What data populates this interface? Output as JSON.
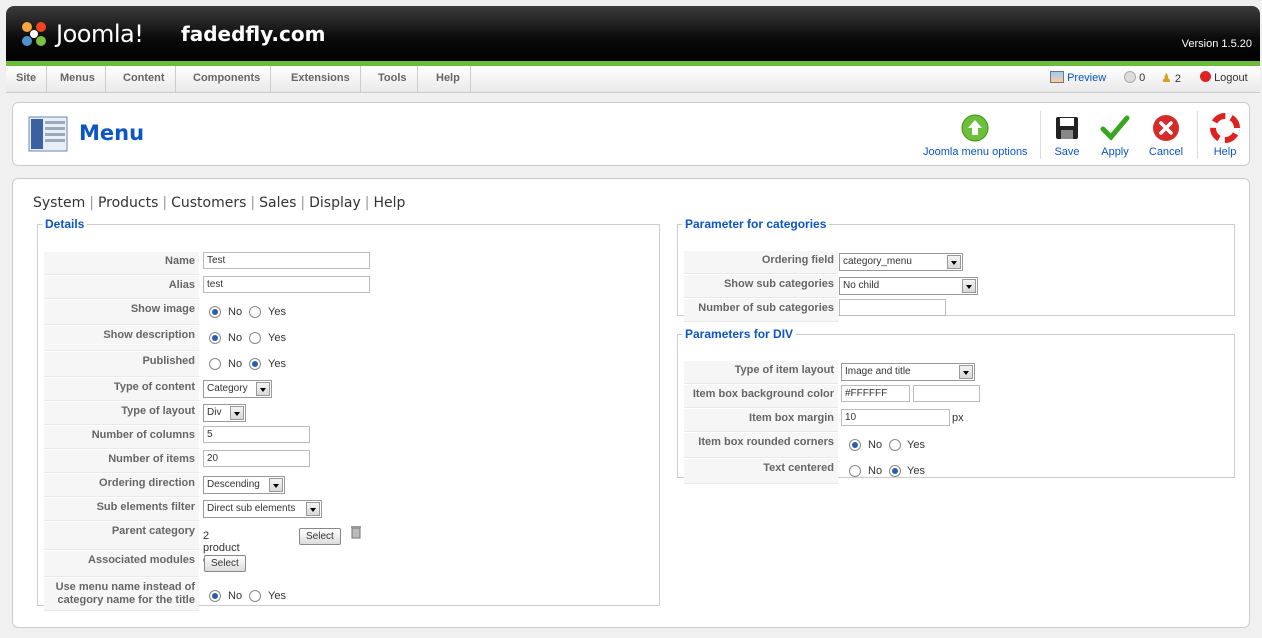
{
  "header": {
    "logo": "Joomla!",
    "site_name": "fadedfly.com",
    "version": "Version 1.5.20"
  },
  "menu": {
    "items": [
      "Site",
      "Menus",
      "Content",
      "Components",
      "Extensions",
      "Tools",
      "Help"
    ]
  },
  "status": {
    "preview": "Preview",
    "messages": "0",
    "users": "2",
    "logout": "Logout"
  },
  "toolbar": {
    "title": "Menu",
    "options_label": "Joomla menu options",
    "save": "Save",
    "apply": "Apply",
    "cancel": "Cancel",
    "help": "Help"
  },
  "tabs": [
    "System",
    "Products",
    "Customers",
    "Sales",
    "Display",
    "Help"
  ],
  "details": {
    "legend": "Details",
    "name_label": "Name",
    "name_value": "Test",
    "alias_label": "Alias",
    "alias_value": "test",
    "show_image_label": "Show image",
    "show_description_label": "Show description",
    "published_label": "Published",
    "type_content_label": "Type of content",
    "type_content_value": "Category",
    "type_layout_label": "Type of layout",
    "type_layout_value": "Div",
    "num_columns_label": "Number of columns",
    "num_columns_value": "5",
    "num_items_label": "Number of items",
    "num_items_value": "20",
    "ordering_direction_label": "Ordering direction",
    "ordering_direction_value": "Descending",
    "sub_filter_label": "Sub elements filter",
    "sub_filter_value": "Direct sub elements",
    "parent_category_label": "Parent category",
    "parent_category_value": "2 product category",
    "select_label": "Select",
    "associated_modules_label": "Associated modules",
    "use_menu_name_label_1": "Use menu name instead of",
    "use_menu_name_label_2": "category name for the title",
    "no": "No",
    "yes": "Yes"
  },
  "categories": {
    "legend": "Parameter for categories",
    "ordering_field_label": "Ordering field",
    "ordering_field_value": "category_menu",
    "show_sub_label": "Show sub categories",
    "show_sub_value": "No child",
    "num_sub_label": "Number of sub categories",
    "num_sub_value": ""
  },
  "div_params": {
    "legend": "Parameters for DIV",
    "item_layout_label": "Type of item layout",
    "item_layout_value": "Image and title",
    "bg_color_label": "Item box background color",
    "bg_color_value": "#FFFFFF",
    "margin_label": "Item box margin",
    "margin_value": "10",
    "margin_unit": "px",
    "rounded_label": "Item box rounded corners",
    "centered_label": "Text centered",
    "no": "No",
    "yes": "Yes"
  },
  "colors": {
    "accent": "#0b55c4",
    "green_bar": "#6dbb3b",
    "header_bg": "#000000"
  }
}
